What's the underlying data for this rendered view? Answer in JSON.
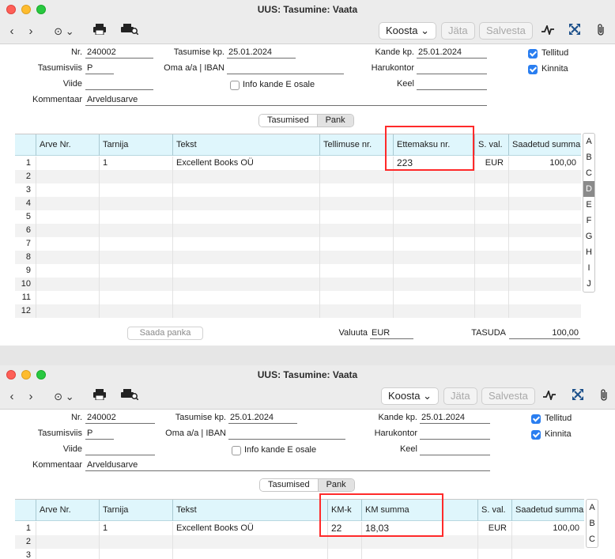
{
  "window_title": "UUS: Tasumine: Vaata",
  "toolbar": {
    "koosta_label": "Koosta",
    "jata_label": "Jäta",
    "salvesta_label": "Salvesta"
  },
  "form": {
    "nr_label": "Nr.",
    "nr_value": "240002",
    "tasumise_kp_label": "Tasumise kp.",
    "tasumise_kp_value": "25.01.2024",
    "kande_kp_label": "Kande kp.",
    "kande_kp_value": "25.01.2024",
    "tasumisviis_label": "Tasumisviis",
    "tasumisviis_value": "P",
    "oma_label": "Oma a/a | IBAN",
    "oma_value": "",
    "harukontor_label": "Harukontor",
    "harukontor_value": "",
    "viide_label": "Viide",
    "viide_value": "",
    "info_kande_label": "Info kande E osale",
    "keel_label": "Keel",
    "keel_value": "",
    "kommentaar_label": "Kommentaar",
    "kommentaar_value": "Arveldusarve",
    "tellitud_label": "Tellitud",
    "kinnita_label": "Kinnita"
  },
  "tabs": [
    "Tasumised",
    "Pank"
  ],
  "grid1": {
    "headers": [
      "Arve Nr.",
      "Tarnija",
      "Tekst",
      "Tellimuse nr.",
      "Ettemaksu nr.",
      "S. val.",
      "Saadetud summa"
    ],
    "row1": {
      "nr": "1",
      "arve": "",
      "tarnija": "1",
      "tekst": "Excellent Books OÜ",
      "tellimuse": "",
      "ettemaksu": "223",
      "sval": "EUR",
      "saadetud": "100,00"
    },
    "row_numbers": [
      "2",
      "3",
      "4",
      "5",
      "6",
      "7",
      "8",
      "9",
      "10",
      "11",
      "12"
    ]
  },
  "alphabet": [
    "A",
    "B",
    "C",
    "D",
    "E",
    "F",
    "G",
    "H",
    "I",
    "J"
  ],
  "alphabet_selected": "D",
  "footer": {
    "saada_panka_label": "Saada panka",
    "valuuta_label": "Valuuta",
    "valuuta_value": "EUR",
    "tasuda_label": "TASUDA",
    "tasuda_value": "100,00"
  },
  "grid2": {
    "headers": [
      "Arve Nr.",
      "Tarnija",
      "Tekst",
      "KM-k",
      "KM summa",
      "S. val.",
      "Saadetud summa"
    ],
    "row1": {
      "nr": "1",
      "arve": "",
      "tarnija": "1",
      "tekst": "Excellent Books OÜ",
      "kmk": "22",
      "kmsumma": "18,03",
      "sval": "EUR",
      "saadetud": "100,00"
    },
    "row_numbers": [
      "2",
      "3"
    ]
  },
  "alphabet2": [
    "A",
    "B",
    "C"
  ],
  "colors": {
    "highlight": "#ff2a2a",
    "grid_header": "#dff6fc",
    "checkbox": "#2a7ef0"
  }
}
